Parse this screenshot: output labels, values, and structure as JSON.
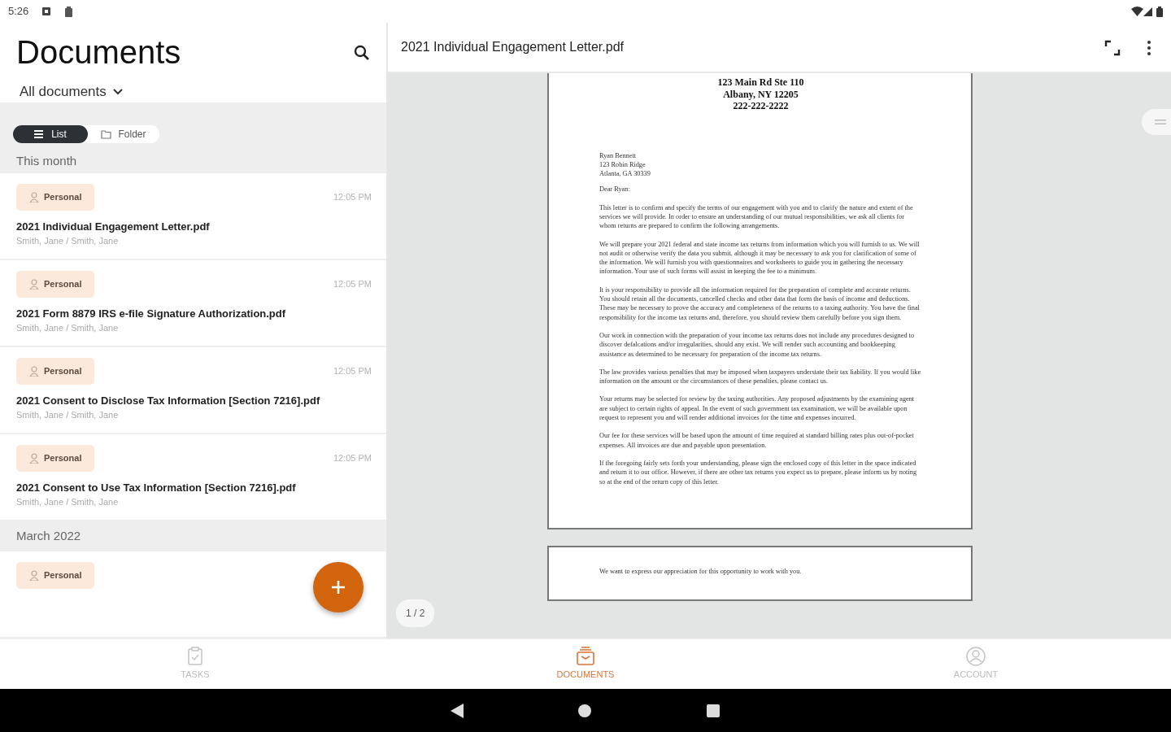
{
  "status_bar": {
    "time": "5:26"
  },
  "sidebar": {
    "title": "Documents",
    "filter": "All documents",
    "view_toggle": [
      {
        "label": "List",
        "selected": true
      },
      {
        "label": "Folder",
        "selected": false
      }
    ],
    "sections": [
      {
        "heading": "This month",
        "items": [
          {
            "tag": "Personal",
            "time": "12:05 PM",
            "title": "2021 Individual Engagement Letter.pdf",
            "owner": "Smith, Jane / Smith, Jane"
          },
          {
            "tag": "Personal",
            "time": "12:05 PM",
            "title": "2021 Form 8879 IRS e-file Signature Authorization.pdf",
            "owner": "Smith, Jane / Smith, Jane"
          },
          {
            "tag": "Personal",
            "time": "12:05 PM",
            "title": "2021 Consent to Disclose Tax Information [Section 7216].pdf",
            "owner": "Smith, Jane / Smith, Jane"
          },
          {
            "tag": "Personal",
            "time": "12:05 PM",
            "title": "2021 Consent to Use Tax Information [Section 7216].pdf",
            "owner": "Smith, Jane / Smith, Jane"
          }
        ]
      },
      {
        "heading": "March 2022",
        "items": [
          {
            "tag": "Personal"
          }
        ]
      }
    ]
  },
  "viewer": {
    "title": "2021 Individual Engagement Letter.pdf",
    "page_indicator": "1 / 2",
    "pages": [
      {
        "address_lines": [
          "123 Main Rd Ste 110",
          "Albany, NY 12205",
          "222-222-2222"
        ],
        "recipient_lines": [
          "Ryan Bennett",
          "123 Robin Ridge",
          "Atlanta, GA 30339"
        ],
        "salutation": "Dear Ryan:",
        "paragraphs": [
          "This letter is to confirm and specify the terms of our engagement with you and to clarify the nature and extent of the services we will provide. In order to ensure an understanding of our mutual responsibilities, we ask all clients for whom returns are prepared to confirm the following arrangements.",
          "We will prepare your 2021 federal and state income tax returns from information which you will furnish to us. We will not audit or otherwise verify the data you submit, although it may be necessary to ask you for clarification of some of the information. We will furnish you with questionnaires and worksheets to guide you in gathering the necessary information. Your use of such forms will assist in keeping the fee to a minimum.",
          "It is your responsibility to provide all the information required for the preparation of complete and accurate returns. You should retain all the documents, cancelled checks and other data that form the basis of income and deductions. These may be necessary to prove the accuracy and completeness of the returns to a taxing authority. You have the final responsibility for the income tax returns and, therefore, you should review them carefully before you sign them.",
          "Our work in connection with the preparation of your income tax returns does not include any procedures designed to discover defalcations and/or irregularities, should any exist. We will render such accounting and bookkeeping assistance as determined to be necessary for preparation of the income tax returns.",
          "The law provides various penalties that may be imposed when taxpayers understate their tax liability. If you would like information on the amount or the circumstances of these penalties, please contact us.",
          "Your returns may be selected for review by the taxing authorities. Any proposed adjustments by the examining agent are subject to certain rights of appeal. In the event of such government tax examination, we will be available upon request to represent you and will render additional invoices for the time and expenses incurred.",
          "Our fee for these services will be based upon the amount of time required at standard billing rates plus out-of-pocket expenses. All invoices are due and payable upon presentation.",
          "If the foregoing fairly sets forth your understanding, please sign the enclosed copy of this letter in the space indicated and return it to our office. However, if there are other tax returns you expect us to prepare, please inform us by noting so at the end of the return copy of this letter."
        ]
      },
      {
        "paragraphs": [
          "We want to express our appreciation for this opportunity to work with you."
        ]
      }
    ]
  },
  "bottom_nav": [
    {
      "kind": "tasks",
      "label": "TASKS",
      "selected": false
    },
    {
      "kind": "documents",
      "label": "DOCUMENTS",
      "selected": true
    },
    {
      "kind": "account",
      "label": "ACCOUNT",
      "selected": false
    }
  ]
}
